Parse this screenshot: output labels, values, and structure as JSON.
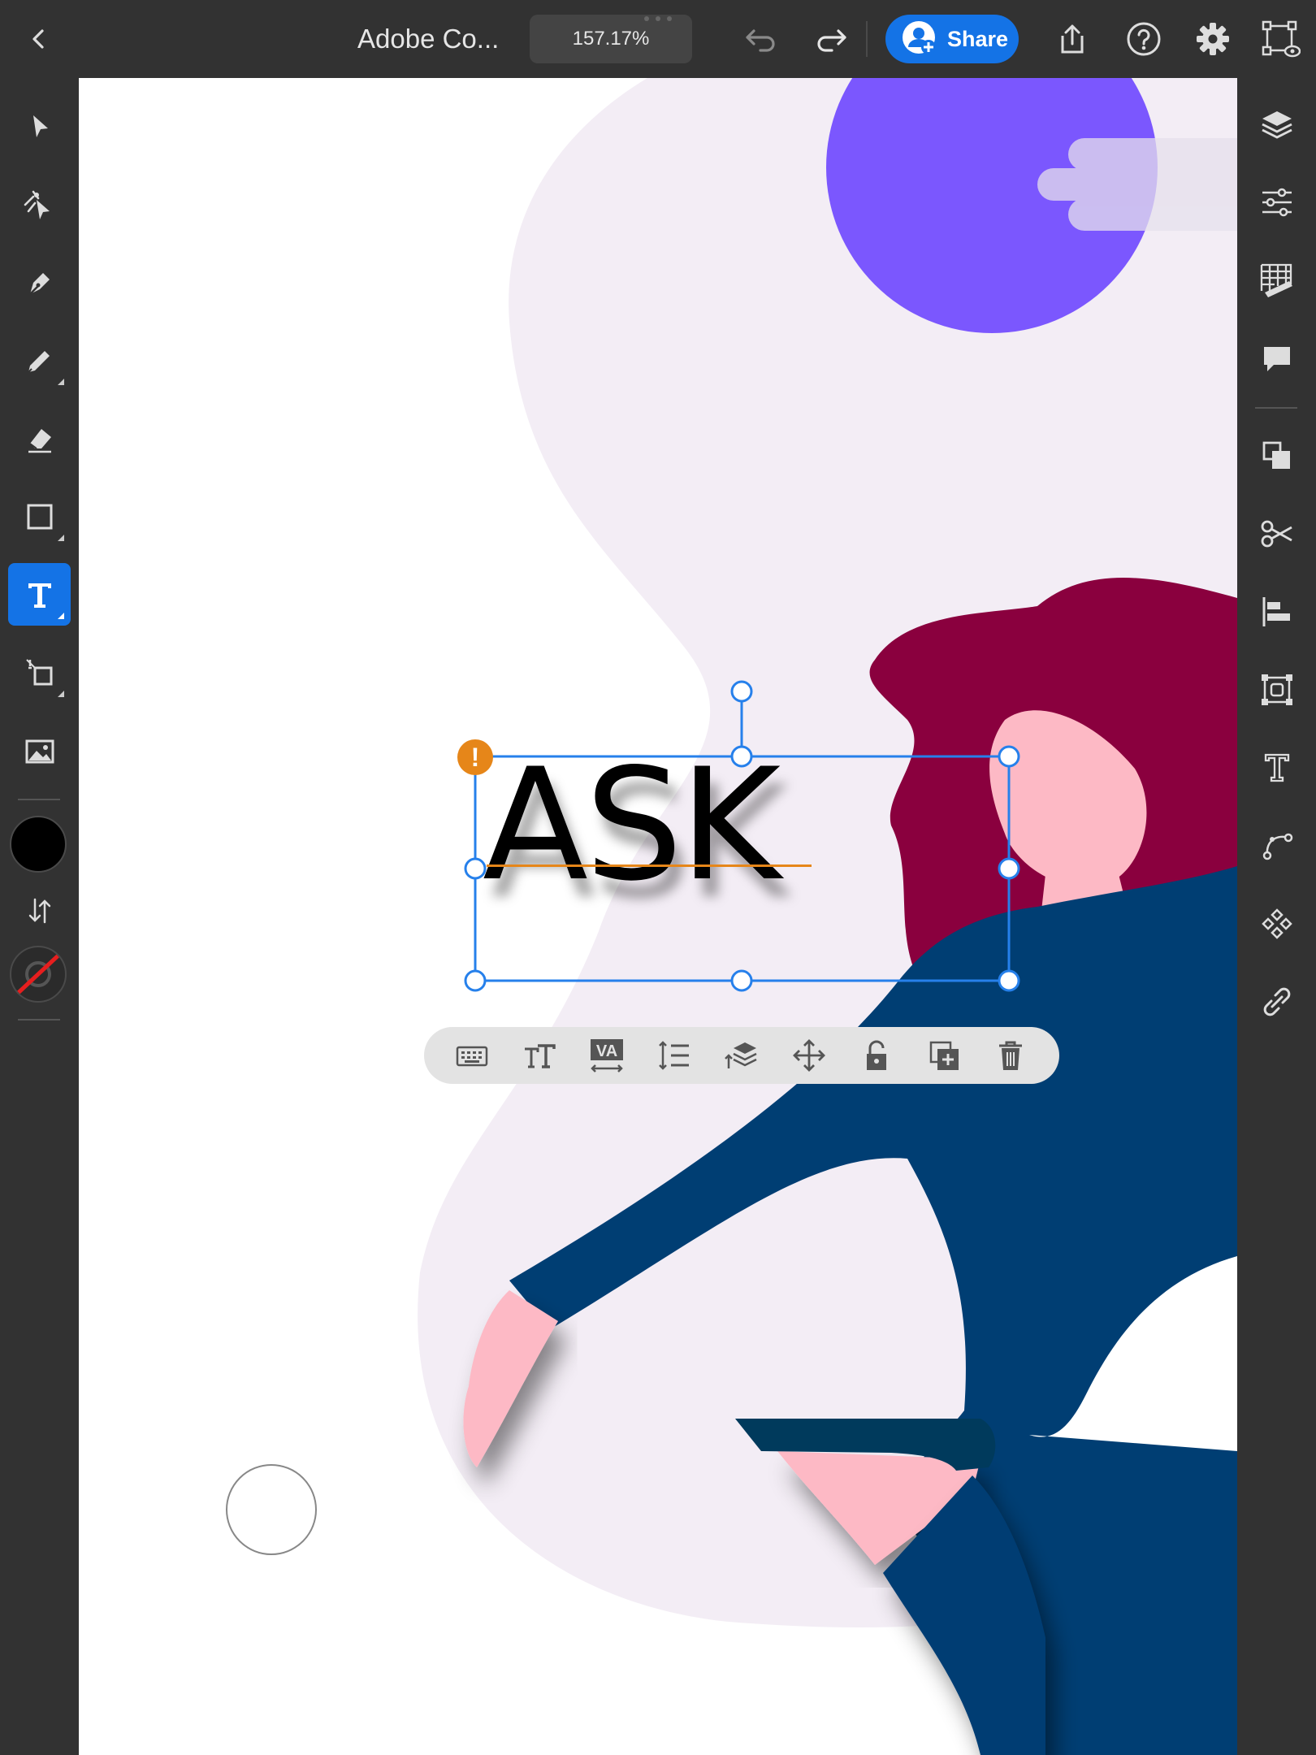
{
  "topbar": {
    "back_icon": "chevron-left-icon",
    "document_title": "Adobe Co...",
    "zoom_level": "157.17%",
    "share_label": "Share",
    "undo_icon": "undo-icon",
    "redo_icon": "redo-icon",
    "export_icon": "export-icon",
    "help_icon": "help-icon",
    "settings_icon": "gear-icon",
    "preview_icon": "preview-icon"
  },
  "left_tools": [
    {
      "name": "selection-tool",
      "icon": "arrow-pointer-icon"
    },
    {
      "name": "direct-selection-tool",
      "icon": "direct-select-icon"
    },
    {
      "name": "pen-tool",
      "icon": "pen-icon"
    },
    {
      "name": "pencil-tool",
      "icon": "pencil-icon"
    },
    {
      "name": "eraser-tool",
      "icon": "eraser-icon"
    },
    {
      "name": "shape-tool",
      "icon": "rectangle-icon"
    },
    {
      "name": "type-tool",
      "icon": "type-icon",
      "active": true
    },
    {
      "name": "transform-tool",
      "icon": "transform-icon"
    },
    {
      "name": "image-tool",
      "icon": "image-icon"
    }
  ],
  "colors": {
    "fill": "#000000",
    "stroke": "none",
    "accent": "#1473e6",
    "warning": "#e68619",
    "selection": "#2680eb",
    "purple_circle": "#7b57fe",
    "hair": "#8a003e",
    "jacket": "#003e73",
    "skin": "#fdb9c5",
    "backdrop": "#f3edf5"
  },
  "right_panel": [
    {
      "name": "layers-button",
      "icon": "layers-icon"
    },
    {
      "name": "properties-button",
      "icon": "sliders-icon"
    },
    {
      "name": "grids-button",
      "icon": "grid-ruler-icon"
    },
    {
      "name": "comments-button",
      "icon": "comment-icon"
    },
    {
      "name": "arrange-button",
      "icon": "arrange-icon"
    },
    {
      "name": "cut-button",
      "icon": "scissors-icon"
    },
    {
      "name": "align-button",
      "icon": "align-left-icon"
    },
    {
      "name": "repeat-grid-button",
      "icon": "repeat-icon"
    },
    {
      "name": "text-properties-button",
      "icon": "text-icon"
    },
    {
      "name": "path-button",
      "icon": "path-icon"
    },
    {
      "name": "libraries-button",
      "icon": "libraries-icon"
    },
    {
      "name": "link-button",
      "icon": "link-icon"
    }
  ],
  "canvas": {
    "selected_text": "ASK",
    "warning_glyph": "!"
  },
  "context_toolbar": [
    {
      "name": "keyboard-button",
      "icon": "keyboard-icon"
    },
    {
      "name": "font-size-button",
      "icon": "font-size-icon"
    },
    {
      "name": "tracking-button",
      "icon": "tracking-icon"
    },
    {
      "name": "line-spacing-button",
      "icon": "line-spacing-icon"
    },
    {
      "name": "arrange-layer-button",
      "icon": "layers-arrange-icon"
    },
    {
      "name": "move-button",
      "icon": "move-icon"
    },
    {
      "name": "lock-button",
      "icon": "unlock-icon"
    },
    {
      "name": "duplicate-button",
      "icon": "duplicate-icon"
    },
    {
      "name": "delete-button",
      "icon": "trash-icon"
    }
  ]
}
